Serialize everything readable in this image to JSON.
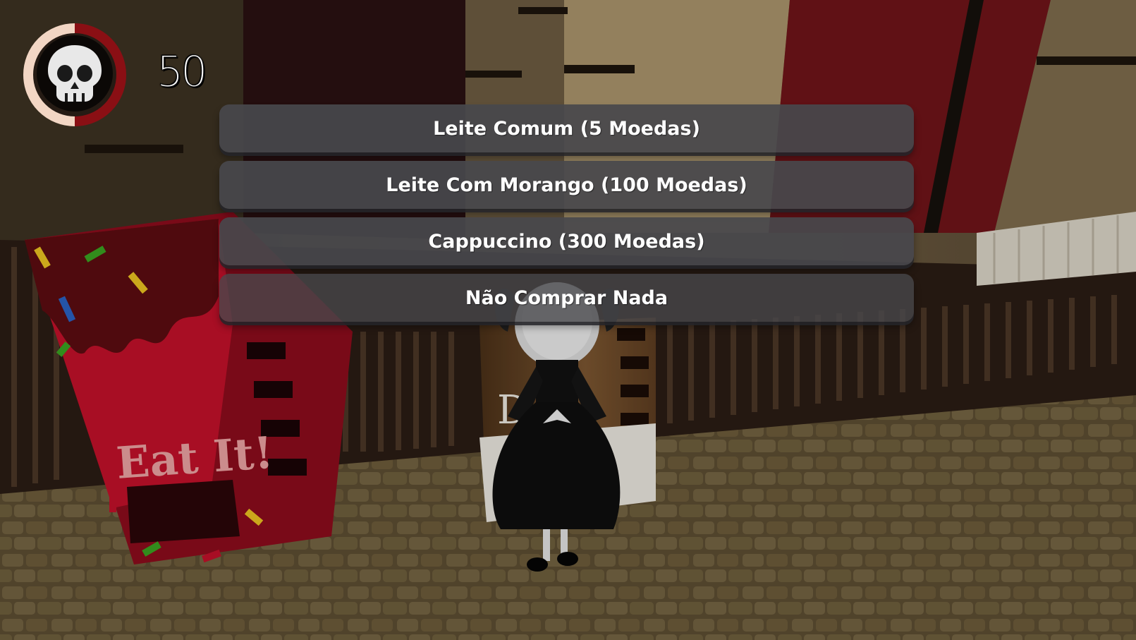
{
  "hud": {
    "coins": "50",
    "health_icon": "skull-icon"
  },
  "shop_menu": {
    "options": [
      {
        "label": "Leite Comum (5 Moedas)"
      },
      {
        "label": "Leite Com Morango (100 Moedas)"
      },
      {
        "label": "Cappuccino (300 Moedas)"
      },
      {
        "label": "Não Comprar Nada"
      }
    ]
  },
  "scene": {
    "vending_machine_sign": "Eat It!",
    "milk_machine_letter": "D"
  },
  "colors": {
    "button_bg": "#48484c",
    "health_ring_light": "#f2d6c4",
    "health_ring_dark": "#8a0f14",
    "machine_red": "#c0102a"
  }
}
